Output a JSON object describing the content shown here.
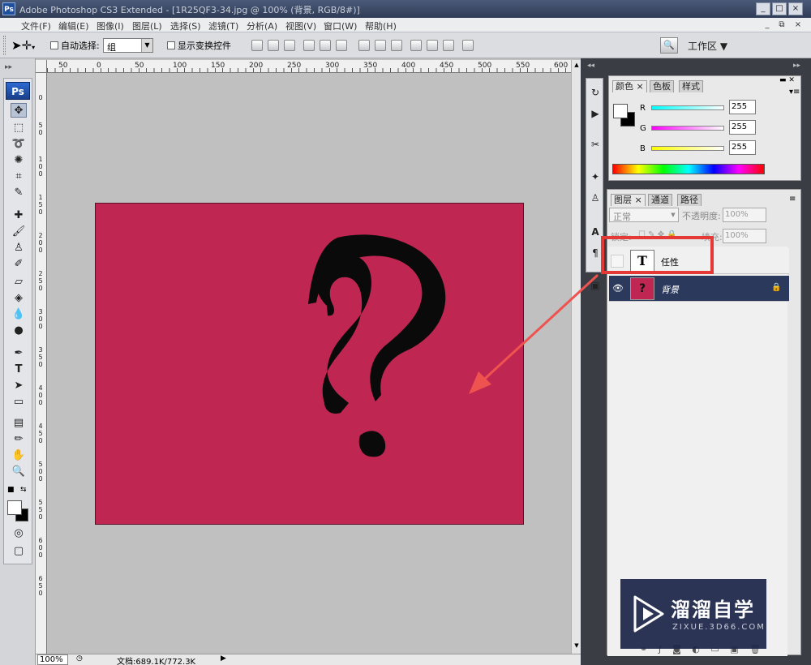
{
  "window": {
    "app_badge": "Ps",
    "title": "Adobe Photoshop CS3 Extended - [1R25QF3-34.jpg @ 100% (背景, RGB/8#)]",
    "controls": [
      "_",
      "□",
      "×"
    ],
    "doc_controls": [
      "_",
      "⧉",
      "×"
    ]
  },
  "menu": [
    "文件(F)",
    "编辑(E)",
    "图像(I)",
    "图层(L)",
    "选择(S)",
    "滤镜(T)",
    "分析(A)",
    "视图(V)",
    "窗口(W)",
    "帮助(H)"
  ],
  "options": {
    "auto_select_label": "自动选择:",
    "auto_select_value": "组",
    "show_transform_label": "显示变换控件",
    "workspace_label": "工作区"
  },
  "rulers": {
    "top": [
      "50",
      "0",
      "50",
      "100",
      "150",
      "200",
      "250",
      "300",
      "350",
      "400",
      "450",
      "500",
      "550",
      "600"
    ],
    "left": [
      "0",
      "5 0",
      "1 0 0",
      "1 5 0",
      "2 0 0",
      "2 5 0",
      "3 0 0",
      "3 5 0",
      "4 0 0",
      "4 5 0",
      "5 0 0",
      "5 5 0",
      "6 0 0",
      "6 5 0"
    ]
  },
  "status": {
    "zoom": "100%",
    "doc_info": "文档:689.1K/772.3K"
  },
  "color_panel": {
    "tabs": [
      "颜色",
      "色板",
      "样式"
    ],
    "channels": [
      {
        "label": "R",
        "value": "255"
      },
      {
        "label": "G",
        "value": "255"
      },
      {
        "label": "B",
        "value": "255"
      }
    ]
  },
  "layers_panel": {
    "tabs": [
      "图层",
      "通道",
      "路径"
    ],
    "blend_mode": "正常",
    "opacity_label": "不透明度:",
    "opacity_value": "100%",
    "lock_label": "锁定:",
    "fill_label": "填充:",
    "fill_value": "100%",
    "layers": [
      {
        "name": "任性",
        "thumb_glyph": "T",
        "visible": false,
        "selected": false
      },
      {
        "name": "背景",
        "thumb_glyph": "?",
        "visible": true,
        "selected": true
      }
    ]
  },
  "watermark": {
    "brand": "溜溜自学",
    "url": "ZIXUE.3D66.COM"
  },
  "colors": {
    "canvas_bg": "#c0c0c0",
    "document_fill": "#c02652",
    "highlight_box": "#e53935",
    "arrow": "#ef5350",
    "selected_layer": "#2b3a5c"
  }
}
